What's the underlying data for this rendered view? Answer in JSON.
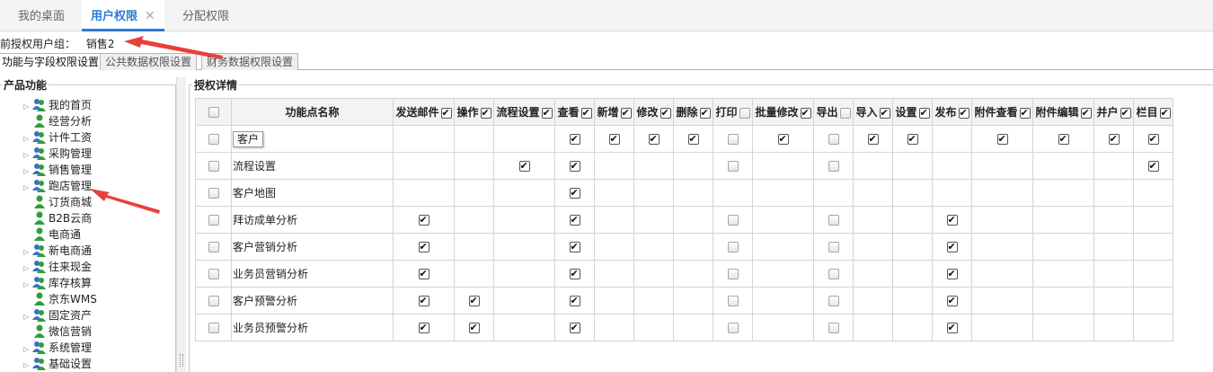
{
  "top_tabs": [
    {
      "label": "我的桌面",
      "active": false
    },
    {
      "label": "用户权限",
      "active": true,
      "close": "✕"
    },
    {
      "label": "分配权限",
      "active": false
    }
  ],
  "user_group": {
    "label": "前授权用户组：",
    "value": "销售2"
  },
  "sub_tabs": [
    {
      "label": "功能与字段权限设置",
      "active": true
    },
    {
      "label": "公共数据权限设置",
      "active": false
    },
    {
      "label": "财务数据权限设置",
      "active": false
    }
  ],
  "left_panel": {
    "legend": "产品功能",
    "items": [
      {
        "label": "我的首页",
        "expandable": true,
        "icon": "user-group-icon"
      },
      {
        "label": "经营分析",
        "expandable": false,
        "icon": "user-icon"
      },
      {
        "label": "计件工资",
        "expandable": true,
        "icon": "user-group-icon"
      },
      {
        "label": "采购管理",
        "expandable": true,
        "icon": "user-group-icon"
      },
      {
        "label": "销售管理",
        "expandable": true,
        "icon": "user-group-icon"
      },
      {
        "label": "跑店管理",
        "expandable": true,
        "icon": "user-group-icon"
      },
      {
        "label": "订货商城",
        "expandable": false,
        "icon": "user-icon"
      },
      {
        "label": "B2B云商",
        "expandable": false,
        "icon": "user-icon"
      },
      {
        "label": "电商通",
        "expandable": false,
        "icon": "user-icon"
      },
      {
        "label": "新电商通",
        "expandable": true,
        "icon": "user-group-icon"
      },
      {
        "label": "往来现金",
        "expandable": true,
        "icon": "user-group-icon"
      },
      {
        "label": "库存核算",
        "expandable": true,
        "icon": "user-group-icon"
      },
      {
        "label": "京东WMS",
        "expandable": false,
        "icon": "user-icon"
      },
      {
        "label": "固定资产",
        "expandable": true,
        "icon": "user-group-icon"
      },
      {
        "label": "微信营销",
        "expandable": false,
        "icon": "user-icon"
      },
      {
        "label": "系统管理",
        "expandable": true,
        "icon": "user-group-icon"
      },
      {
        "label": "基础设置",
        "expandable": true,
        "icon": "user-group-icon"
      }
    ]
  },
  "right_panel": {
    "legend": "授权详情",
    "name_header": "功能点名称",
    "columns": [
      {
        "label": "发送邮件",
        "checked": true
      },
      {
        "label": "操作",
        "checked": true
      },
      {
        "label": "流程设置",
        "checked": true
      },
      {
        "label": "查看",
        "checked": true
      },
      {
        "label": "新增",
        "checked": true
      },
      {
        "label": "修改",
        "checked": true
      },
      {
        "label": "删除",
        "checked": true
      },
      {
        "label": "打印",
        "checked": false
      },
      {
        "label": "批量修改",
        "checked": true
      },
      {
        "label": "导出",
        "checked": false
      },
      {
        "label": "导入",
        "checked": true
      },
      {
        "label": "设置",
        "checked": true
      },
      {
        "label": "发布",
        "checked": true
      },
      {
        "label": "附件查看",
        "checked": true
      },
      {
        "label": "附件编辑",
        "checked": true
      },
      {
        "label": "并户",
        "checked": true
      },
      {
        "label": "栏目",
        "checked": true
      }
    ],
    "rows": [
      {
        "name": "客户",
        "tooltip": "客户",
        "cells": [
          null,
          null,
          null,
          true,
          true,
          true,
          true,
          false,
          true,
          false,
          true,
          true,
          null,
          true,
          true,
          true,
          true
        ]
      },
      {
        "name": "流程设置",
        "cells": [
          null,
          null,
          true,
          true,
          null,
          null,
          null,
          false,
          null,
          false,
          null,
          null,
          null,
          null,
          null,
          null,
          true
        ]
      },
      {
        "name": "客户地图",
        "cells": [
          null,
          null,
          null,
          true,
          null,
          null,
          null,
          null,
          null,
          null,
          null,
          null,
          null,
          null,
          null,
          null,
          null
        ]
      },
      {
        "name": "拜访成单分析",
        "cells": [
          true,
          null,
          null,
          true,
          null,
          null,
          null,
          false,
          null,
          false,
          null,
          null,
          true,
          null,
          null,
          null,
          null
        ]
      },
      {
        "name": "客户营销分析",
        "cells": [
          true,
          null,
          null,
          true,
          null,
          null,
          null,
          false,
          null,
          false,
          null,
          null,
          true,
          null,
          null,
          null,
          null
        ]
      },
      {
        "name": "业务员营销分析",
        "cells": [
          true,
          null,
          null,
          true,
          null,
          null,
          null,
          false,
          null,
          false,
          null,
          null,
          true,
          null,
          null,
          null,
          null
        ]
      },
      {
        "name": "客户预警分析",
        "cells": [
          true,
          true,
          null,
          true,
          null,
          null,
          null,
          false,
          null,
          false,
          null,
          null,
          true,
          null,
          null,
          null,
          null
        ]
      },
      {
        "name": "业务员预警分析",
        "cells": [
          true,
          true,
          null,
          true,
          null,
          null,
          null,
          false,
          null,
          false,
          null,
          null,
          true,
          null,
          null,
          null,
          null
        ]
      }
    ]
  },
  "colors": {
    "accent": "#2d7ad8",
    "arrow": "#e8403a",
    "icon_head": "#2f9e3c",
    "icon_body": "#3a6fc4"
  }
}
